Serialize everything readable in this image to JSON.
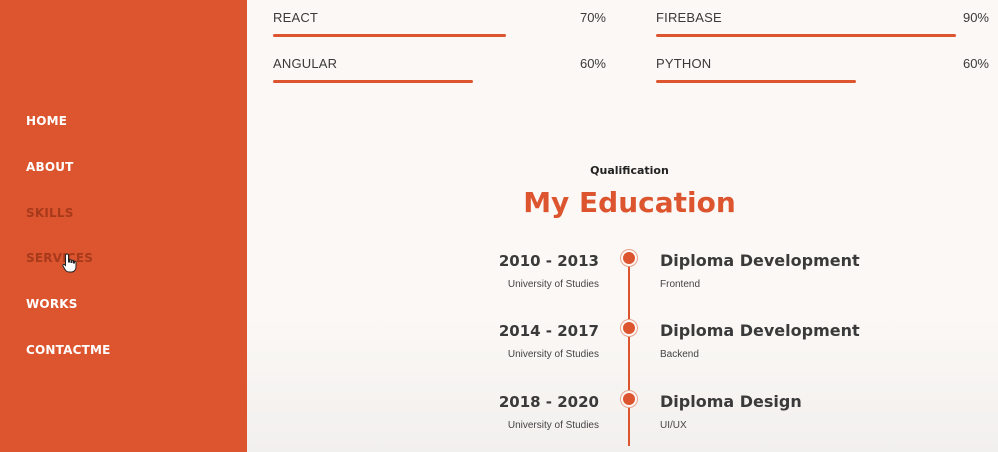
{
  "sidebar": {
    "items": [
      {
        "label": "HOME"
      },
      {
        "label": "ABOUT"
      },
      {
        "label": "SKILLS"
      },
      {
        "label": "SERVICES"
      },
      {
        "label": "WORKS"
      },
      {
        "label": "CONTACTME"
      }
    ],
    "active_index": 3,
    "background": "#dc552f"
  },
  "skills": [
    {
      "name": "REACT",
      "percent_label": "70%",
      "level": 0.7
    },
    {
      "name": "FIREBASE",
      "percent_label": "90%",
      "level": 0.9
    },
    {
      "name": "ANGULAR",
      "percent_label": "60%",
      "level": 0.6
    },
    {
      "name": "PYTHON",
      "percent_label": "60%",
      "level": 0.6
    }
  ],
  "qualification": {
    "subtitle": "Qualification",
    "title": "My Education",
    "entries": [
      {
        "years": "2010 - 2013",
        "school": "University of Studies",
        "degree": "Diploma Development",
        "field": "Frontend"
      },
      {
        "years": "2014 - 2017",
        "school": "University of Studies",
        "degree": "Diploma Development",
        "field": "Backend"
      },
      {
        "years": "2018 - 2020",
        "school": "University of Studies",
        "degree": "Diploma Design",
        "field": "UI/UX"
      }
    ]
  },
  "colors": {
    "accent": "#dc552f",
    "text": "#3a3a3a",
    "background": "#fbf8f5"
  }
}
